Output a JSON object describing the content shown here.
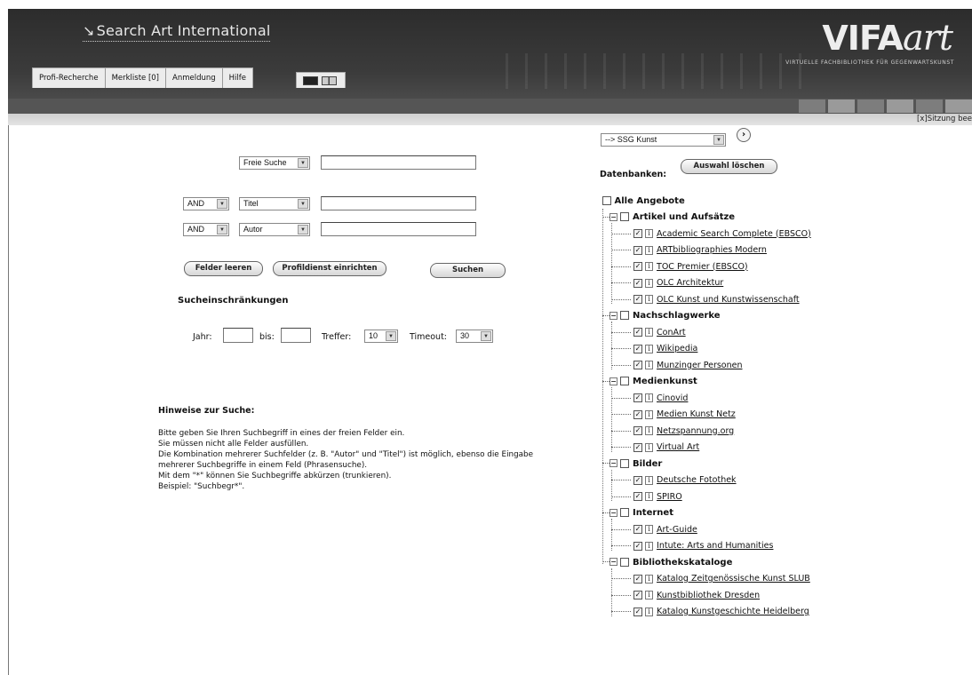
{
  "header": {
    "site_title": "Search Art International",
    "logo_brand": "VIFA",
    "logo_script": "art",
    "logo_tagline": "VIRTUELLE FACHBIBLIOTHEK FÜR GEGENWARTSKUNST"
  },
  "nav": {
    "tabs": [
      {
        "label": "Profi-Recherche"
      },
      {
        "label": "Merkliste [0]"
      },
      {
        "label": "Anmeldung"
      },
      {
        "label": "Hilfe"
      }
    ]
  },
  "session": "[x]Sitzung bee",
  "search": {
    "free_field": "Freie Suche",
    "row2": {
      "op": "AND",
      "field": "Titel"
    },
    "row3": {
      "op": "AND",
      "field": "Autor"
    },
    "clear_button": "Felder leeren",
    "profile_button": "Profildienst einrichten",
    "search_button": "Suchen"
  },
  "restrictions": {
    "heading": "Sucheinschränkungen",
    "year_label": "Jahr:",
    "to_label": "bis:",
    "hits_label": "Treffer:",
    "hits_value": "10",
    "timeout_label": "Timeout:",
    "timeout_value": "30"
  },
  "hints": {
    "heading": "Hinweise zur Suche:",
    "lines": [
      "Bitte geben Sie Ihren Suchbegriff in eines der freien Felder ein.",
      "Sie müssen nicht alle Felder ausfüllen.",
      "Die Kombination mehrerer Suchfelder (z. B. \"Autor\" und \"Titel\") ist möglich, ebenso die Eingabe",
      "mehrerer Suchbegriffe in einem Feld (Phrasensuche).",
      "Mit dem \"*\" können Sie Suchbegriffe abkürzen (trunkieren).",
      "Beispiel: \"Suchbegr*\"."
    ]
  },
  "databases": {
    "collection_select": "--> SSG Kunst",
    "label": "Datenbanken:",
    "clear_selection": "Auswahl löschen",
    "all_label": "Alle Angebote",
    "categories": [
      {
        "name": "Artikel und Aufsätze",
        "items": [
          "Academic Search Complete (EBSCO)",
          "ARTbibliographies Modern",
          "TOC Premier (EBSCO)",
          "OLC Architektur",
          "OLC Kunst und Kunstwissenschaft"
        ]
      },
      {
        "name": "Nachschlagwerke",
        "items": [
          "ConArt",
          "Wikipedia",
          "Munzinger Personen"
        ]
      },
      {
        "name": "Medienkunst",
        "items": [
          "Cinovid",
          "Medien Kunst Netz",
          "Netzspannung.org",
          "Virtual Art"
        ]
      },
      {
        "name": "Bilder",
        "items": [
          "Deutsche Fotothek",
          "SPIRO"
        ]
      },
      {
        "name": "Internet",
        "items": [
          "Art-Guide",
          "Intute: Arts and Humanities"
        ]
      },
      {
        "name": "Bibliothekskataloge",
        "items": [
          "Katalog Zeitgenössische Kunst SLUB",
          "Kunstbibliothek Dresden",
          "Katalog Kunstgeschichte Heidelberg"
        ]
      }
    ]
  }
}
